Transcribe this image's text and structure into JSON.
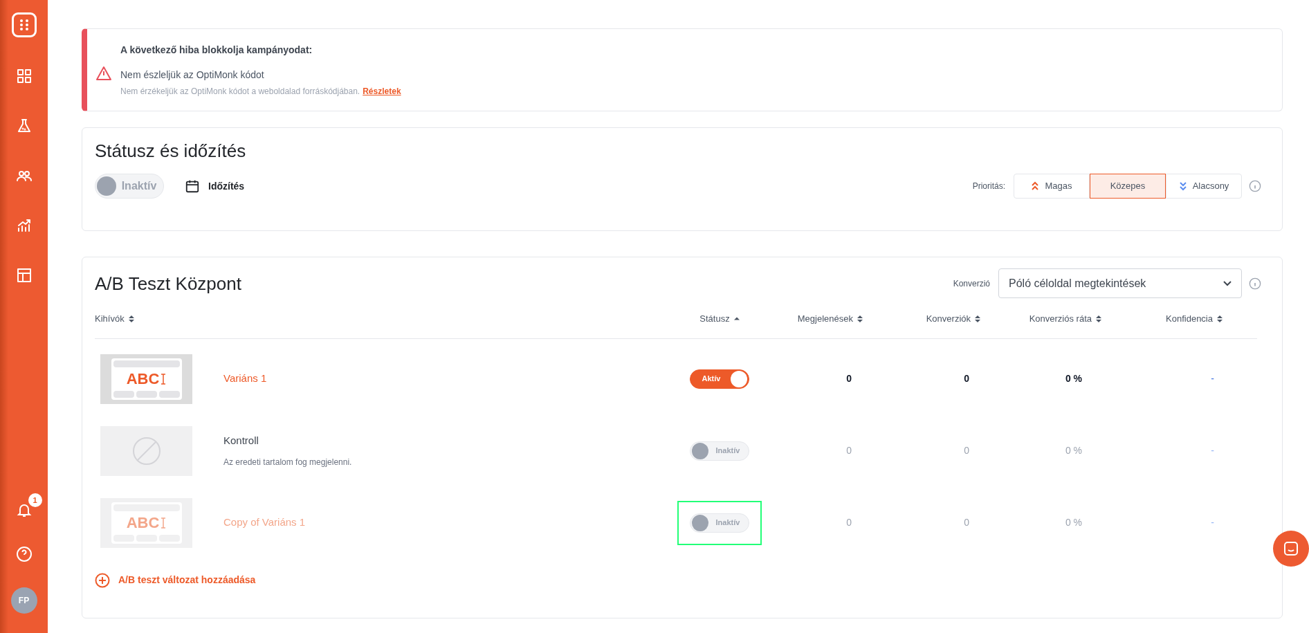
{
  "sidebar": {
    "notifications": {
      "count": "1"
    },
    "avatar": "FP"
  },
  "alert": {
    "title": "A következő hiba blokkolja kampányodat:",
    "message": "Nem észleljük az OptiMonk kódot",
    "detail": "Nem érzékeljük az OptiMonk kódot a weboldalad forráskódjában.",
    "link": "Részletek"
  },
  "status_card": {
    "title": "Státusz és időzítés",
    "toggle": {
      "label": "Inaktív",
      "on": false
    },
    "schedule": "Időzítés",
    "priority_label": "Prioritás:",
    "priorities": [
      {
        "label": "Magas",
        "kind": "up",
        "selected": false
      },
      {
        "label": "Közepes",
        "kind": "none",
        "selected": true
      },
      {
        "label": "Alacsony",
        "kind": "down",
        "selected": false
      }
    ]
  },
  "ab_card": {
    "title": "A/B Teszt Központ",
    "conversion_label": "Konverzió",
    "conversion_value": "Póló céloldal megtekintések",
    "columns": [
      {
        "label": "Kihívók",
        "sorted": false
      },
      {
        "label": "Státusz",
        "sorted": true
      },
      {
        "label": "Megjelenések",
        "sorted": false
      },
      {
        "label": "Konverziók",
        "sorted": false
      },
      {
        "label": "Konverziós ráta",
        "sorted": false
      },
      {
        "label": "Konfidencia",
        "sorted": false
      }
    ],
    "rows": [
      {
        "kind": "variant",
        "thumb_text": "ABC",
        "name": "Variáns 1",
        "status": "Aktív",
        "on": true,
        "highlighted": false,
        "impressions": "0",
        "conversions": "0",
        "rate": "0 %",
        "confidence": "-"
      },
      {
        "kind": "control",
        "name": "Kontroll",
        "subtitle": "Az eredeti tartalom fog megjelenni.",
        "status": "Inaktív",
        "on": false,
        "highlighted": false,
        "impressions": "0",
        "conversions": "0",
        "rate": "0 %",
        "confidence": "-"
      },
      {
        "kind": "variant",
        "thumb_text": "ABC",
        "name": "Copy of Variáns 1",
        "status": "Inaktív",
        "on": false,
        "highlighted": true,
        "impressions": "0",
        "conversions": "0",
        "rate": "0 %",
        "confidence": "-"
      }
    ],
    "add_label": "A/B teszt változat hozzáadása"
  }
}
